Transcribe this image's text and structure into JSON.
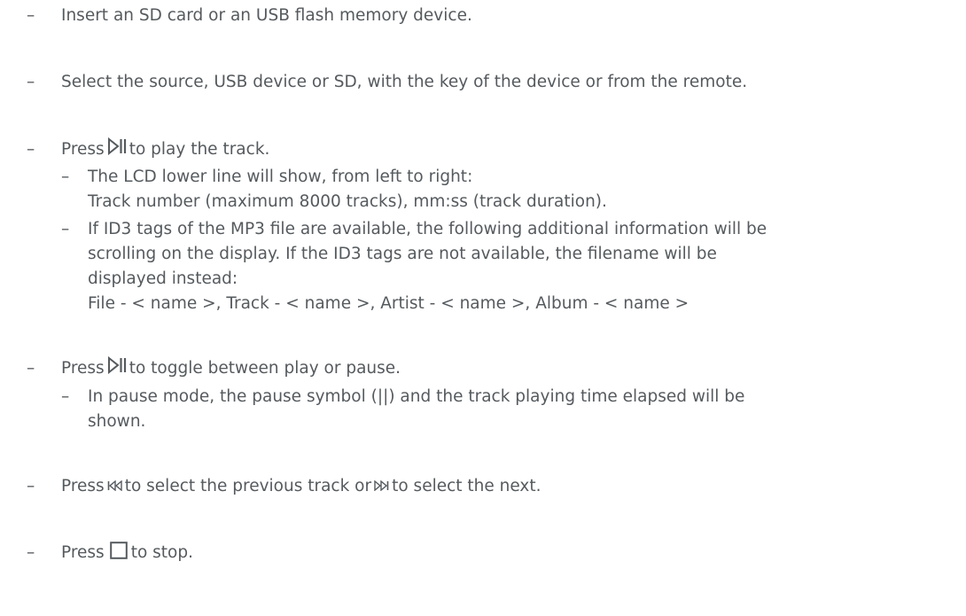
{
  "bullet": "–",
  "items": [
    {
      "text": "Insert an SD card or an USB flash memory device."
    },
    {
      "text": "Select the source, USB device or SD, with the key of the device or from the remote."
    },
    {
      "before": "Press",
      "icon": "play-pause-icon",
      "after": "to play the track.",
      "sub": [
        {
          "lines": [
            "The LCD lower line will show, from left to right:",
            "Track number (maximum 8000 tracks), mm:ss (track duration)."
          ]
        },
        {
          "lines": [
            "If ID3 tags of the MP3 file are available, the following additional information will be",
            "scrolling on the display. If the ID3 tags are not available, the filename will be",
            "displayed instead:",
            "File - < name >, Track - < name >, Artist - < name >, Album - < name >"
          ]
        }
      ]
    },
    {
      "before": "Press",
      "icon": "play-pause-icon",
      "after": "to toggle between play or pause.",
      "sub": [
        {
          "lines": [
            "In pause mode, the pause symbol (||) and the track playing time elapsed will be",
            "shown."
          ]
        }
      ]
    },
    {
      "before": "Press",
      "icon1": "previous-track-icon",
      "middle": "to select the previous track or",
      "icon2": "next-track-icon",
      "after": "to select the next."
    },
    {
      "before": "Press",
      "icon": "stop-icon",
      "after": "to stop."
    }
  ]
}
